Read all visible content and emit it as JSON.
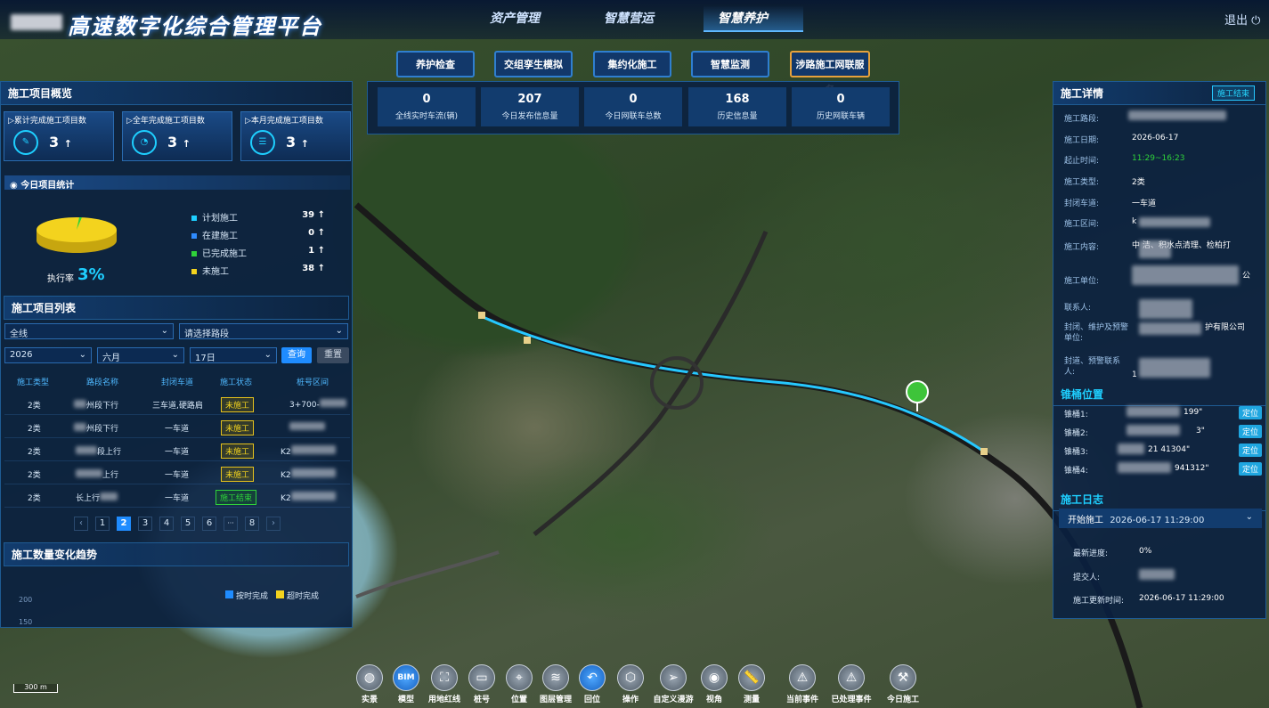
{
  "header": {
    "title": "高速数字化综合管理平台",
    "tabs": [
      "资产管理",
      "智慧营运",
      "智慧养护"
    ],
    "active_tab": 2,
    "logout": "退出"
  },
  "subtabs": [
    "养护检查",
    "交组孪生模拟",
    "集约化施工",
    "智慧监测",
    "涉路施工网联服务"
  ],
  "stats": [
    {
      "v": "0",
      "l": "全线实时车流(辆)"
    },
    {
      "v": "207",
      "l": "今日发布信息量"
    },
    {
      "v": "0",
      "l": "今日网联车总数"
    },
    {
      "v": "168",
      "l": "历史信息量"
    },
    {
      "v": "0",
      "l": "历史网联车辆"
    }
  ],
  "overview": {
    "title": "施工项目概览",
    "cards": [
      {
        "l": "累计完成施工项目数",
        "v": "3"
      },
      {
        "l": "全年完成施工项目数",
        "v": "3"
      },
      {
        "l": "本月完成施工项目数",
        "v": "3"
      }
    ],
    "today_title": "今日项目统计",
    "legend": [
      {
        "l": "计划施工",
        "v": "39",
        "c": "#1ecfff"
      },
      {
        "l": "在建施工",
        "v": "0",
        "c": "#2f8cff"
      },
      {
        "l": "已完成施工",
        "v": "1",
        "c": "#2fd23a"
      },
      {
        "l": "未施工",
        "v": "38",
        "c": "#f3d31e"
      }
    ],
    "rate_label": "执行率",
    "rate": "3%"
  },
  "list": {
    "title": "施工项目列表",
    "f1": "全线",
    "f2": "请选择路段",
    "year": "2026",
    "month": "六月",
    "day": "17日",
    "query": "查询",
    "reset": "重置",
    "headers": [
      "施工类型",
      "路段名称",
      "封闭车道",
      "施工状态",
      "桩号区间"
    ],
    "rows": [
      {
        "type": "2类",
        "road": "州段下行",
        "lane": "三车道,硬路肩",
        "status": "未施工",
        "pile": "3+700-",
        "done": false
      },
      {
        "type": "2类",
        "road": "州段下行",
        "lane": "一车道",
        "status": "未施工",
        "pile": "",
        "done": false
      },
      {
        "type": "2类",
        "road": "段上行",
        "lane": "一车道",
        "status": "未施工",
        "pile": "K2",
        "done": false
      },
      {
        "type": "2类",
        "road": "上行",
        "lane": "一车道",
        "status": "未施工",
        "pile": "K2",
        "done": false
      },
      {
        "type": "2类",
        "road": "长上行",
        "lane": "一车道",
        "status": "施工结束",
        "pile": "K2",
        "done": true
      }
    ],
    "pages": [
      "‹",
      "1",
      "2",
      "3",
      "4",
      "5",
      "6",
      "···",
      "8",
      "›"
    ],
    "active_page": "2"
  },
  "trend": {
    "title": "施工数量变化趋势",
    "legend": [
      "按时完成",
      "超时完成"
    ],
    "ticks": [
      "200",
      "150"
    ]
  },
  "detail": {
    "title": "施工详情",
    "badge": "施工结束",
    "fields": [
      {
        "k": "施工路段:",
        "v": "",
        "blur": true
      },
      {
        "k": "施工日期:",
        "v": "2026-06-17"
      },
      {
        "k": "起止时间:",
        "v": "11:29~16:23",
        "green": true
      },
      {
        "k": "施工类型:",
        "v": "2类"
      },
      {
        "k": "封闭车道:",
        "v": "一车道"
      },
      {
        "k": "施工区间:",
        "v": "k",
        "blur": true
      },
      {
        "k": "施工内容:",
        "v": "中    洁、积水点清理、检柏打",
        "blur": true
      },
      {
        "k": "施工单位:",
        "v": "公",
        "blur": true
      },
      {
        "k": "联系人:",
        "v": "",
        "blur": true
      },
      {
        "k": "封闭、维护及预警单位:",
        "v": "护有限公司",
        "blur": true
      },
      {
        "k": "封道、预警联系人:",
        "v": "1",
        "blur": true
      }
    ],
    "cone_title": "锥桶位置",
    "cones": [
      {
        "k": "锥桶1:",
        "v": "199\""
      },
      {
        "k": "锥桶2:",
        "v": "3\""
      },
      {
        "k": "锥桶3:",
        "v": "21  41304\""
      },
      {
        "k": "锥桶4:",
        "v": "941312\""
      }
    ],
    "locate": "定位",
    "log_title": "施工日志",
    "log_head": "开始施工",
    "log_time": "2026-06-17 11:29:00",
    "log": [
      {
        "k": "最新进度:",
        "v": "0%"
      },
      {
        "k": "提交人:",
        "v": ""
      },
      {
        "k": "施工更新时间:",
        "v": "2026-06-17 11:29:00"
      }
    ]
  },
  "toolbar": [
    {
      "l": "实景",
      "i": "globe-icon"
    },
    {
      "l": "模型",
      "i": "bim-icon"
    },
    {
      "l": "用地红线",
      "i": "frame-icon"
    },
    {
      "l": "桩号",
      "i": "pile-icon"
    },
    {
      "l": "位置",
      "i": "pin-icon"
    },
    {
      "l": "图层管理",
      "i": "layers-icon"
    },
    {
      "l": "回位",
      "i": "return-icon"
    },
    {
      "l": "操作",
      "i": "cube-icon"
    },
    {
      "l": "自定义漫游",
      "i": "plane-icon"
    },
    {
      "l": "视角",
      "i": "eye-icon"
    },
    {
      "l": "测量",
      "i": "ruler-icon"
    },
    {
      "l": "当前事件",
      "i": "warning-icon"
    },
    {
      "l": "已处理事件",
      "i": "warning-done-icon"
    },
    {
      "l": "今日施工",
      "i": "worker-icon"
    }
  ],
  "scale": "300 m"
}
